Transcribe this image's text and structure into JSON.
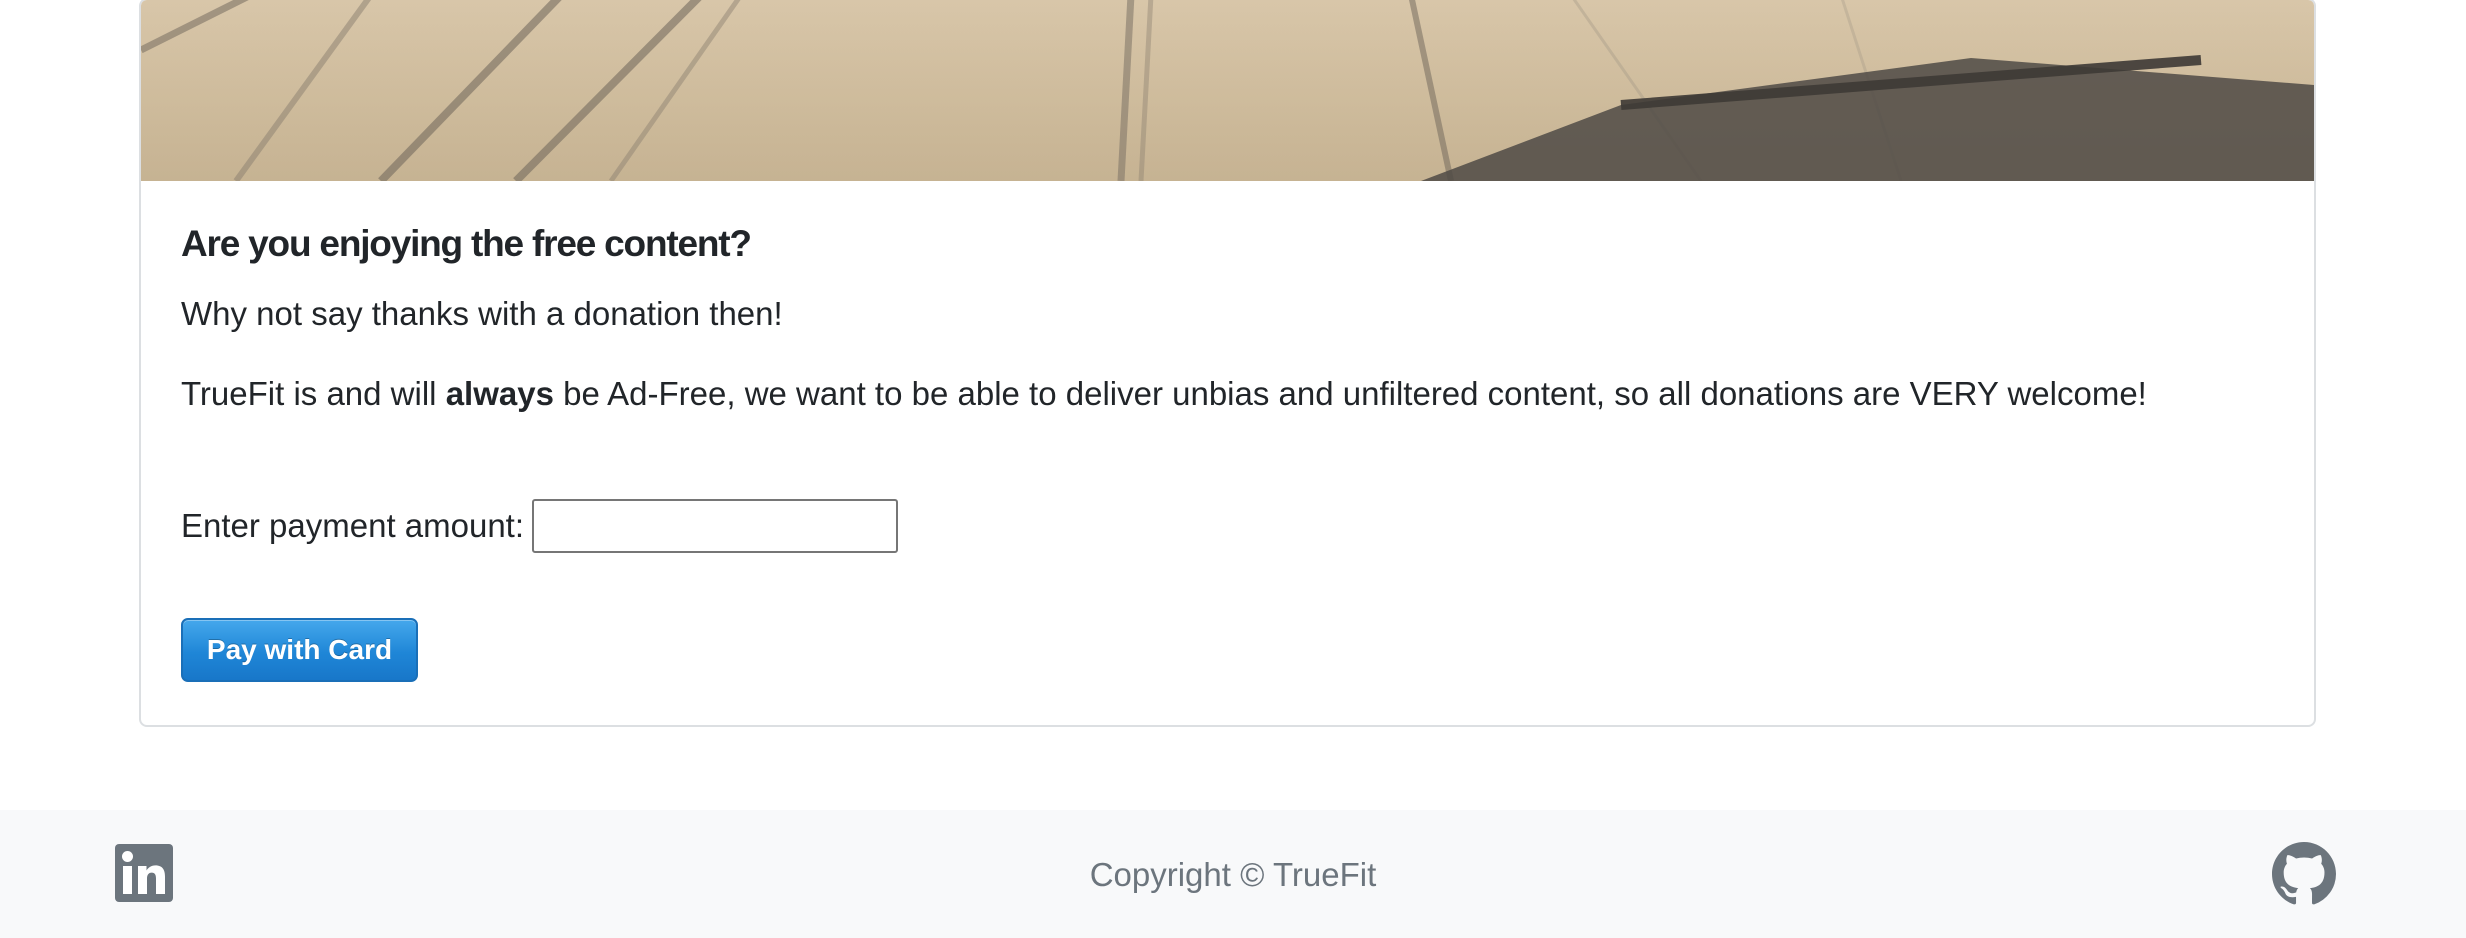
{
  "donation_card": {
    "hero_image": "pavement-shadows-photo",
    "title": "Are you enjoying the free content?",
    "line1": "Why not say thanks with a donation then!",
    "line2_before": "TrueFit is and will ",
    "line2_bold": "always",
    "line2_after": " be Ad-Free, we want to be able to deliver unbias and unfiltered content, so all donations are VERY welcome!",
    "payment_label": "Enter payment amount:",
    "payment_value": "",
    "pay_button_label": "Pay with Card",
    "pay_button_color": "#1f86d7"
  },
  "footer": {
    "linkedin_icon": "linkedin-icon",
    "copyright": "Copyright © TrueFit",
    "github_icon": "github-icon",
    "icon_color": "#6c757d",
    "background": "#f8f9fa"
  }
}
